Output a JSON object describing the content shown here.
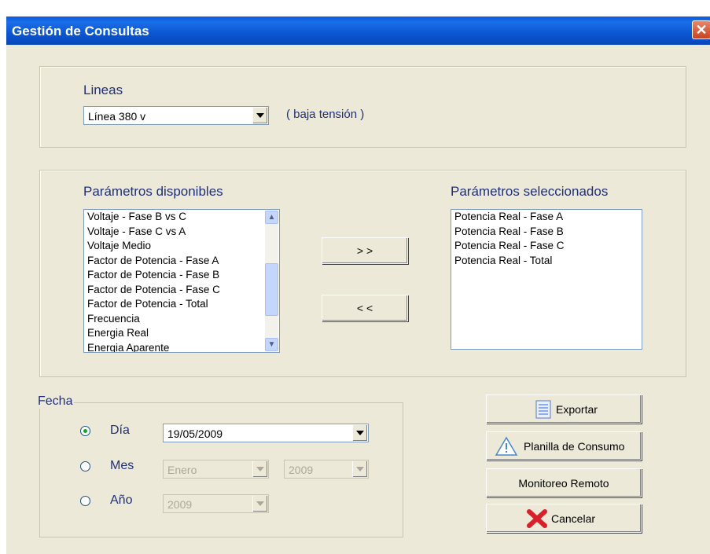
{
  "window": {
    "title": "Gestión de Consultas"
  },
  "lineas": {
    "label": "Lineas",
    "selected": "Línea 380 v",
    "note": "( baja tensión )"
  },
  "parametros": {
    "available_label": "Parámetros disponibles",
    "selected_label": "Parámetros seleccionados",
    "available": [
      "Voltaje - Fase B vs C",
      "Voltaje - Fase C vs A",
      "Voltaje Medio",
      "Factor de Potencia - Fase A",
      "Factor de Potencia - Fase B",
      "Factor de Potencia - Fase C",
      "Factor de Potencia - Total",
      "Frecuencia",
      "Energia Real",
      "Energia Aparente"
    ],
    "selected": [
      "Potencia Real - Fase A",
      "Potencia Real - Fase B",
      "Potencia Real - Fase C",
      "Potencia Real - Total"
    ],
    "add_label": "> >",
    "remove_label": "< <"
  },
  "fecha": {
    "legend": "Fecha",
    "dia_label": "Día",
    "dia_value": "19/05/2009",
    "mes_label": "Mes",
    "mes_value": "Enero",
    "mes_year": "2009",
    "anio_label": "Año",
    "anio_value": "2009",
    "selected": "dia"
  },
  "actions": {
    "exportar": "Exportar",
    "planilla": "Planilla de Consumo",
    "monitoreo": "Monitoreo Remoto",
    "cancelar": "Cancelar"
  },
  "icons": {
    "close": "close-icon",
    "exportar": "document-icon",
    "planilla": "warning-icon",
    "cancelar": "red-x-icon"
  }
}
